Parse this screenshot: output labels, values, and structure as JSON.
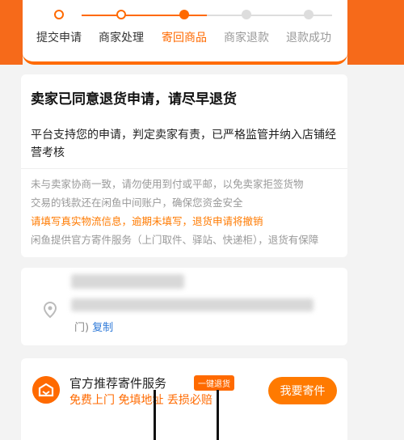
{
  "progress": {
    "steps": [
      {
        "label": "提交申请",
        "state": "done"
      },
      {
        "label": "商家处理",
        "state": "done"
      },
      {
        "label": "寄回商品",
        "state": "current"
      },
      {
        "label": "商家退款",
        "state": "todo"
      },
      {
        "label": "退款成功",
        "state": "todo"
      }
    ]
  },
  "notice": {
    "title": "卖家已同意退货申请，请尽早退货",
    "description": "平台支持您的申请，判定卖家有责，已严格监管并纳入店铺经营考核",
    "tips": [
      "未与卖家协商一致，请勿使用到付或平邮，以免卖家拒签货物",
      "交易的钱款还在闲鱼中间账户，确保您资金安全",
      "请填写真实物流信息，逾期未填写，退货申请将撤销",
      "闲鱼提供官方寄件服务（上门取件、驿站、快递柜），退货有保障"
    ]
  },
  "address": {
    "tail": "门)",
    "copy_label": "复制"
  },
  "courier": {
    "title": "官方推荐寄件服务",
    "badge": "一键退货",
    "subtitle": "免费上门 免填地址 丢损必赔",
    "button_label": "我要寄件"
  },
  "colors": {
    "accent": "#ff6a00",
    "link": "#2f7ad8"
  }
}
